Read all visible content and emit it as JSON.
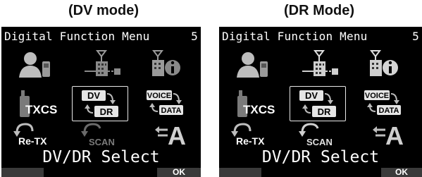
{
  "captions": {
    "left": "(DV mode)",
    "right": "(DR Mode)"
  },
  "screens": [
    {
      "header_title": "Digital Function Menu",
      "header_page": "5",
      "icons": {
        "txcs_label": "TXCS",
        "dv_label": "DV",
        "dr_label": "DR",
        "voice_label": "VOICE",
        "data_label": "DATA",
        "retx_label": "Re-TX",
        "scan_label": "SCAN",
        "a_label": "A"
      },
      "selected_label": "DV/DR Select",
      "soft_right": "OK"
    },
    {
      "header_title": "Digital Function Menu",
      "header_page": "5",
      "icons": {
        "txcs_label": "TXCS",
        "dv_label": "DV",
        "dr_label": "DR",
        "voice_label": "VOICE",
        "data_label": "DATA",
        "retx_label": "Re-TX",
        "scan_label": "SCAN",
        "a_label": "A"
      },
      "selected_label": "DV/DR Select",
      "soft_right": "OK"
    }
  ],
  "colors": {
    "screen_bg": "#000000",
    "icon_gray": "#bdbdbd",
    "dim_gray": "#6a6a6a"
  }
}
